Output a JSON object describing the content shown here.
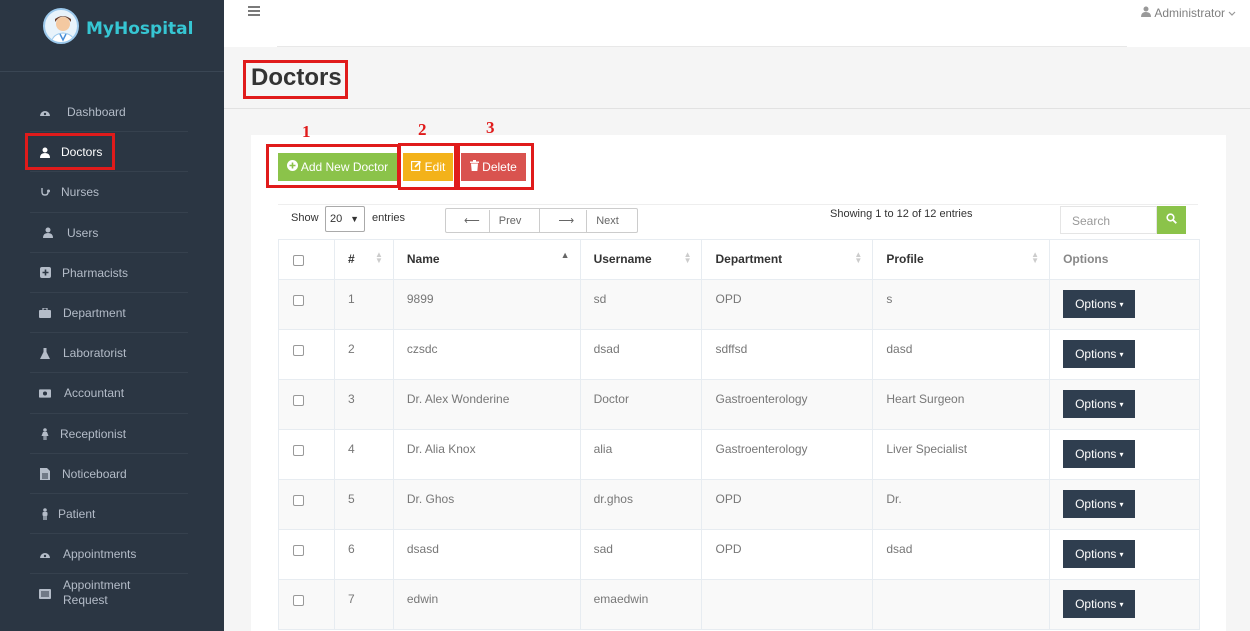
{
  "brand": {
    "name": "MyHospital"
  },
  "sidebar": {
    "items": [
      {
        "label": "Dashboard",
        "icon": "dashboard-icon"
      },
      {
        "label": "Doctors",
        "icon": "doctor-icon",
        "active": true
      },
      {
        "label": "Nurses",
        "icon": "stethoscope-icon"
      },
      {
        "label": "Users",
        "icon": "user-icon"
      },
      {
        "label": "Pharmacists",
        "icon": "plus-square-icon"
      },
      {
        "label": "Department",
        "icon": "briefcase-icon"
      },
      {
        "label": "Laboratorist",
        "icon": "flask-icon"
      },
      {
        "label": "Accountant",
        "icon": "money-icon"
      },
      {
        "label": "Receptionist",
        "icon": "female-icon"
      },
      {
        "label": "Noticeboard",
        "icon": "file-text-icon"
      },
      {
        "label": "Patient",
        "icon": "male-icon"
      },
      {
        "label": "Appointments",
        "icon": "dashboard-icon"
      },
      {
        "label": "Appointment Request",
        "icon": "list-icon"
      }
    ]
  },
  "topbar": {
    "user": "Administrator"
  },
  "page": {
    "title": "Doctors"
  },
  "annotations": {
    "n1": "1",
    "n2": "2",
    "n3": "3"
  },
  "toolbar": {
    "add_label": "Add New Doctor",
    "edit_label": "Edit",
    "delete_label": "Delete"
  },
  "table_controls": {
    "show_label": "Show",
    "page_size": "20",
    "entries_label": "entries",
    "prev_label": "Prev",
    "next_label": "Next",
    "showing_text": "Showing 1 to 12 of 12 entries",
    "search_placeholder": "Search"
  },
  "table": {
    "headers": [
      "#",
      "Name",
      "Username",
      "Department",
      "Profile",
      "Options"
    ],
    "option_label": "Options",
    "rows": [
      {
        "num": "1",
        "name": "9899",
        "username": "sd",
        "department": "OPD",
        "profile": "s"
      },
      {
        "num": "2",
        "name": "czsdc",
        "username": "dsad",
        "department": "sdffsd",
        "profile": "dasd"
      },
      {
        "num": "3",
        "name": "Dr. Alex Wonderine",
        "username": "Doctor",
        "department": "Gastroenterology",
        "profile": "Heart Surgeon"
      },
      {
        "num": "4",
        "name": "Dr. Alia Knox",
        "username": "alia",
        "department": "Gastroenterology",
        "profile": "Liver Specialist"
      },
      {
        "num": "5",
        "name": "Dr. Ghos",
        "username": "dr.ghos",
        "department": "OPD",
        "profile": "Dr."
      },
      {
        "num": "6",
        "name": "dsasd",
        "username": "sad",
        "department": "OPD",
        "profile": "dsad"
      },
      {
        "num": "7",
        "name": "edwin",
        "username": "emaedwin",
        "department": "",
        "profile": ""
      }
    ]
  },
  "colors": {
    "sidebar_bg": "#2b3643",
    "brand": "#36c6d3",
    "add": "#8bc34a",
    "edit": "#f3b21a",
    "delete": "#d9534f",
    "options": "#2f3e4f",
    "highlight": "#e01b1b"
  }
}
